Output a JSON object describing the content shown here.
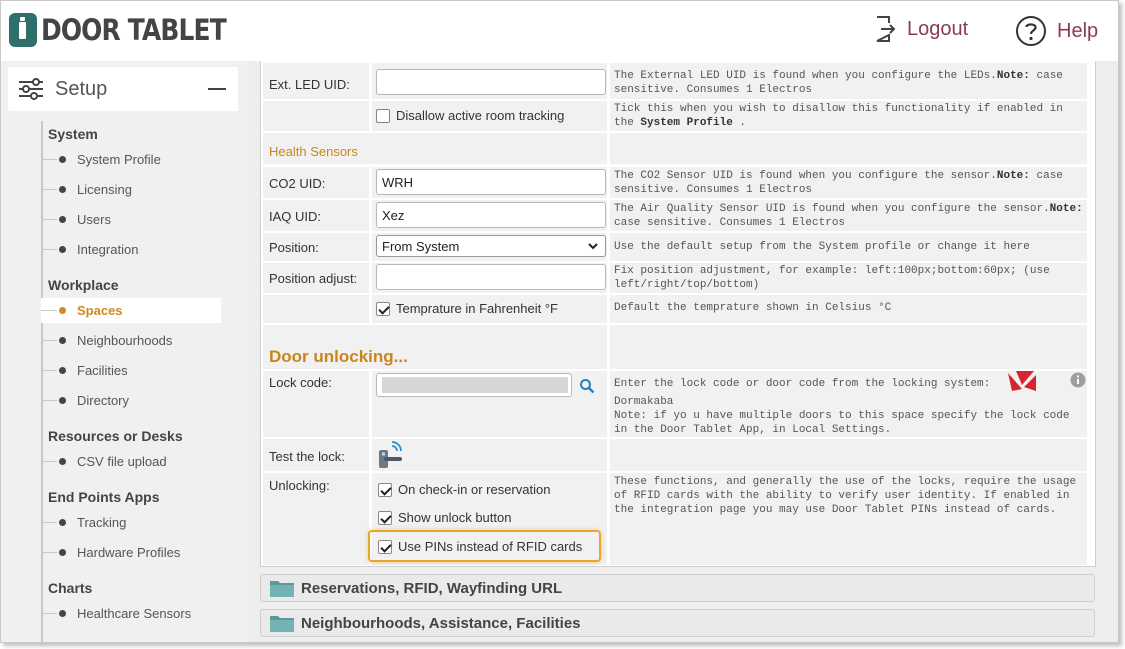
{
  "brand": {
    "name": "DOOR TABLET"
  },
  "header": {
    "logout_label": "Logout",
    "help_label": "Help"
  },
  "sidebar": {
    "setup_label": "Setup",
    "sections": [
      {
        "title": "System",
        "items": [
          "System Profile",
          "Licensing",
          "Users",
          "Integration"
        ]
      },
      {
        "title": "Workplace",
        "items": [
          "Spaces",
          "Neighbourhoods",
          "Facilities",
          "Directory"
        ]
      },
      {
        "title": "Resources or Desks",
        "items": [
          "CSV file upload"
        ]
      },
      {
        "title": "End Points Apps",
        "items": [
          "Tracking",
          "Hardware Profiles"
        ]
      },
      {
        "title": "Charts",
        "items": [
          "Healthcare Sensors"
        ]
      }
    ],
    "active_item": "Spaces",
    "accent_color": "#d08a22"
  },
  "form": {
    "ext_led": {
      "label": "Ext. LED UID:",
      "value": "",
      "desc_pre": "The External LED UID is found when you configure the LEDs.",
      "desc_note": "Note:",
      "desc_post": " case sensitive. Consumes 1 Electros"
    },
    "disallow": {
      "label": "Disallow active room tracking",
      "checked": false,
      "desc_pre": "Tick this when you wish to disallow this functionality if enabled in the ",
      "desc_bold": "System Profile",
      "desc_post": " ."
    },
    "health_title": "Health Sensors",
    "co2": {
      "label": "CO2 UID:",
      "value": "WRH",
      "desc_pre": "The CO2 Sensor UID is found when you configure the sensor.",
      "desc_note": "Note:",
      "desc_post": " case sensitive. Consumes 1 Electros"
    },
    "iaq": {
      "label": "IAQ UID:",
      "value": "Xez",
      "desc_pre": "The Air Quality Sensor UID is found when you configure the sensor.",
      "desc_note": "Note:",
      "desc_post": " case sensitive. Consumes 1 Electros"
    },
    "position": {
      "label": "Position:",
      "value": "From System",
      "desc": "Use the default setup from the System profile or change it here"
    },
    "position_adjust": {
      "label": "Position adjust:",
      "value": "",
      "desc": "Fix position adjustment, for example: left:100px;bottom:60px; (use left/right/top/bottom)"
    },
    "fahrenheit": {
      "label": "Temprature in Fahrenheit °F",
      "checked": true,
      "desc": "Default the temprature shown in Celsius °C"
    },
    "door_title": "Door unlocking...",
    "lock_code": {
      "label": "Lock code:",
      "desc_line1": "Enter the lock code or door code from the locking system:",
      "vendor": "Dormakaba",
      "desc_note": "Note: if yo u have multiple doors to this space specify the lock code in the Door Tablet App, in Local Settings."
    },
    "test_lock": {
      "label": "Test the lock:"
    },
    "unlocking": {
      "label": "Unlocking:",
      "options": [
        {
          "label": "On check-in or reservation",
          "checked": true
        },
        {
          "label": "Show unlock button",
          "checked": true
        },
        {
          "label": "Use PINs instead of RFID cards",
          "checked": true
        }
      ],
      "desc": "These functions, and generally the use of the locks, require the usage of RFID cards with the ability to verify user identity.  If enabled in the integration page you may use Door Tablet PINs instead of cards."
    }
  },
  "accordions": [
    "Reservations, RFID, Wayfinding URL",
    "Neighbourhoods, Assistance, Facilities"
  ],
  "colors": {
    "header_link": "#8a3a5a",
    "section_title": "#c9861e",
    "highlight": "#e9a62a"
  }
}
